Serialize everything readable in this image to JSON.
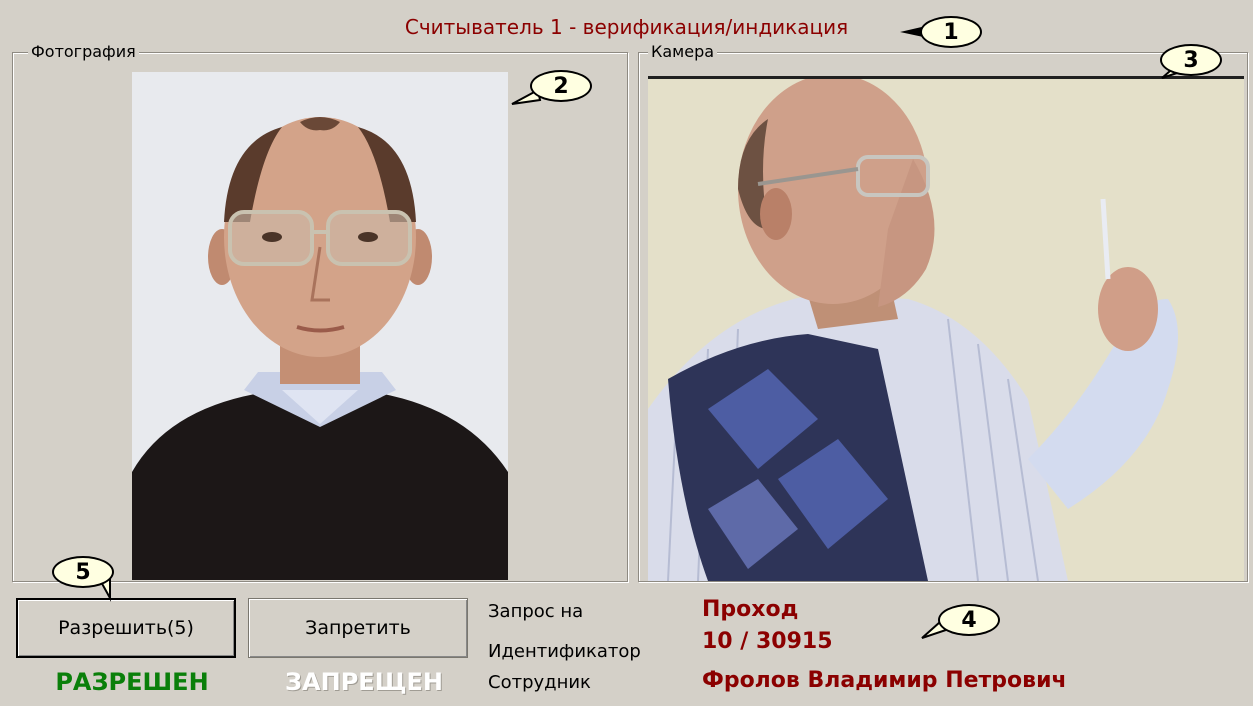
{
  "title": "Считыватель 1 - верификация/индикация",
  "photo_group": {
    "label": "Фотография"
  },
  "camera_group": {
    "label": "Камера"
  },
  "buttons": {
    "allow": "Разрешить(5)",
    "deny": "Запретить"
  },
  "status": {
    "allowed": "РАЗРЕШЕН",
    "denied": "ЗАПРЕЩЕН"
  },
  "info": {
    "request_label": "Запрос на",
    "request_value": "Проход",
    "identifier_label": "Идентификатор",
    "identifier_value": "10 / 30915",
    "employee_label": "Сотрудник",
    "employee_value": "Фролов Владимир Петрович"
  },
  "callouts": [
    "1",
    "2",
    "3",
    "4",
    "5"
  ],
  "colors": {
    "accent": "#8b0000",
    "allowed": "#0a7f0a",
    "background": "#d4d0c8",
    "callout": "#ffffe1"
  }
}
